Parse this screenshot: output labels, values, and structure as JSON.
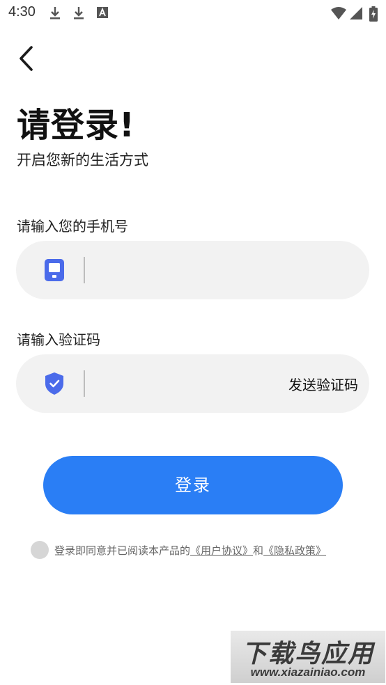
{
  "status_bar": {
    "time": "4:30",
    "icons": [
      "download-icon",
      "download-icon",
      "font-icon",
      "wifi-icon",
      "signal-icon",
      "battery-icon"
    ]
  },
  "header": {
    "title": "请登录!",
    "subtitle": "开启您新的生活方式"
  },
  "phone": {
    "label": "请输入您的手机号",
    "value": "",
    "icon": "phone-icon"
  },
  "code": {
    "label": "请输入验证码",
    "value": "",
    "icon": "shield-icon",
    "send_label": "发送验证码"
  },
  "login": {
    "label": "登录"
  },
  "agreement": {
    "prefix": "登录即同意并已阅读本产品的",
    "user_agreement": "《用户协议》",
    "conjunction": "和",
    "privacy_policy": "《隐私政策》"
  },
  "watermark": {
    "main": "下载鸟应用",
    "sub": "www.xiazainiao.com"
  },
  "colors": {
    "accent": "#2a7ef5",
    "icon_blue": "#4b6bea",
    "field_bg": "#f2f2f2"
  }
}
